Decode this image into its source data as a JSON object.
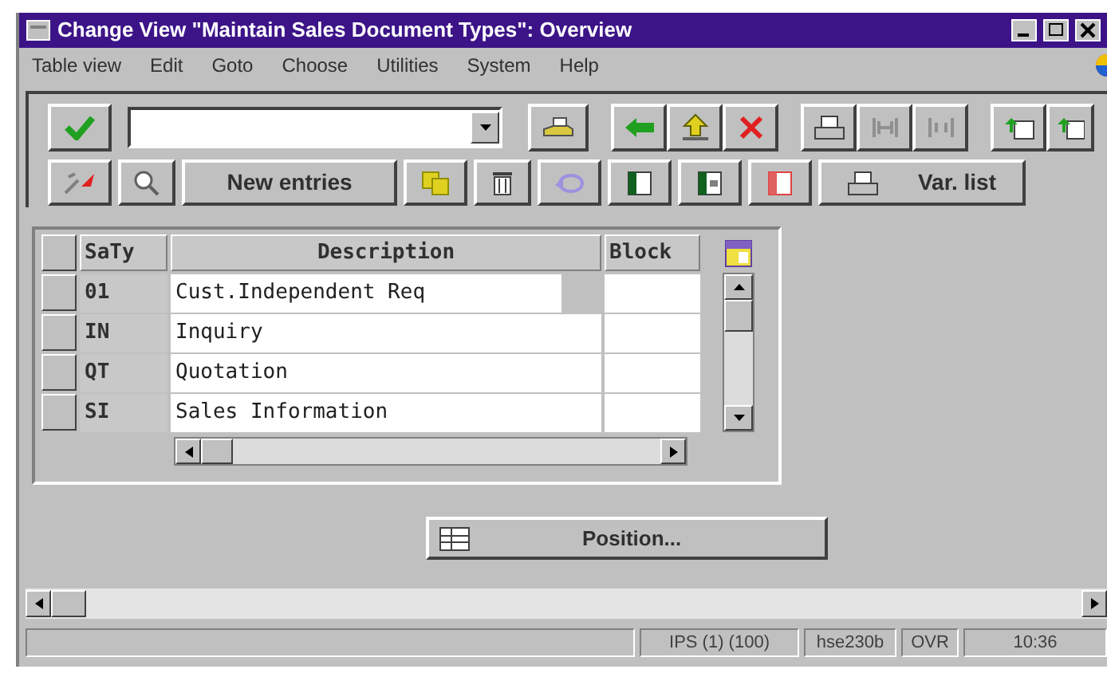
{
  "window": {
    "title": "Change View \"Maintain Sales Document Types\": Overview"
  },
  "menu": [
    "Table view",
    "Edit",
    "Goto",
    "Choose",
    "Utilities",
    "System",
    "Help"
  ],
  "application_toolbar": {
    "new_entries": "New entries",
    "var_list": "Var. list"
  },
  "table": {
    "columns": [
      "SaTy",
      "Description",
      "Block"
    ],
    "rows": [
      {
        "saty": "01",
        "description": "Cust.Independent Req"
      },
      {
        "saty": "IN",
        "description": "Inquiry"
      },
      {
        "saty": "QT",
        "description": "Quotation"
      },
      {
        "saty": "SI",
        "description": "Sales Information"
      }
    ]
  },
  "position_button": "Position...",
  "status_bar": [
    "IPS (1) (100)",
    "hse230b",
    "OVR",
    "10:36"
  ]
}
